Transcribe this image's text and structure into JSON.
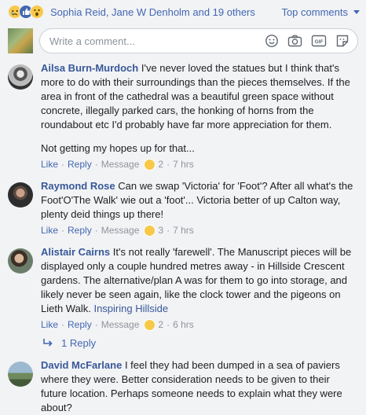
{
  "reactions_bar": {
    "icons": [
      "sad-reaction",
      "like-reaction",
      "wow-reaction"
    ],
    "reactors_text": "Sophia Reid, Jane W Denholm and 19 others",
    "sort_label": "Top comments"
  },
  "composer": {
    "placeholder": "Write a comment...",
    "icons": [
      "emoji-icon",
      "camera-icon",
      "gif-icon",
      "sticker-icon"
    ],
    "gif_label": "GIF"
  },
  "comments": [
    {
      "author": "Ailsa Burn-Murdoch",
      "text": "I've never loved the statues but I think that's more to do with their surroundings than the pieces themselves. If the area in front of the cathedral was a beautiful green space without concrete, illegally parked cars, the honking of horns from the roundabout etc I'd probably have far more appreciation for them.",
      "text2": "Not getting my hopes up for that...",
      "like": "Like",
      "reply": "Reply",
      "message": "Message",
      "reaction_count": "2",
      "time": "7 hrs"
    },
    {
      "author": "Raymond Rose",
      "text": "Can we swap 'Victoria' for 'Foot'? After all what's the Foot'O'The Walk' wie out a 'foot'... Victoria better of up Calton way, plenty deid things up there!",
      "like": "Like",
      "reply": "Reply",
      "message": "Message",
      "reaction_count": "3",
      "time": "7 hrs"
    },
    {
      "author": "Alistair Cairns",
      "text": "It's not really 'farewell'. The Manuscript pieces will be displayed only a couple hundred metres away - in Hillside Crescent gardens. The alternative/plan A was for them to go into storage, and likely never be seen again, like the clock tower and the pigeons on Lieth Walk.",
      "link_text": "Inspiring Hillside",
      "like": "Like",
      "reply": "Reply",
      "message": "Message",
      "reaction_count": "2",
      "time": "6 hrs",
      "replies_label": "1 Reply"
    },
    {
      "author": "David McFarlane",
      "text": "I feel they had been dumped in a sea of paviers where they were. Better consideration needs to be given to their future location. Perhaps someone needs to explain what they were about?"
    }
  ],
  "colors": {
    "link": "#4267b2",
    "author": "#385898",
    "meta": "#90949c",
    "background": "#f2f3f5"
  }
}
